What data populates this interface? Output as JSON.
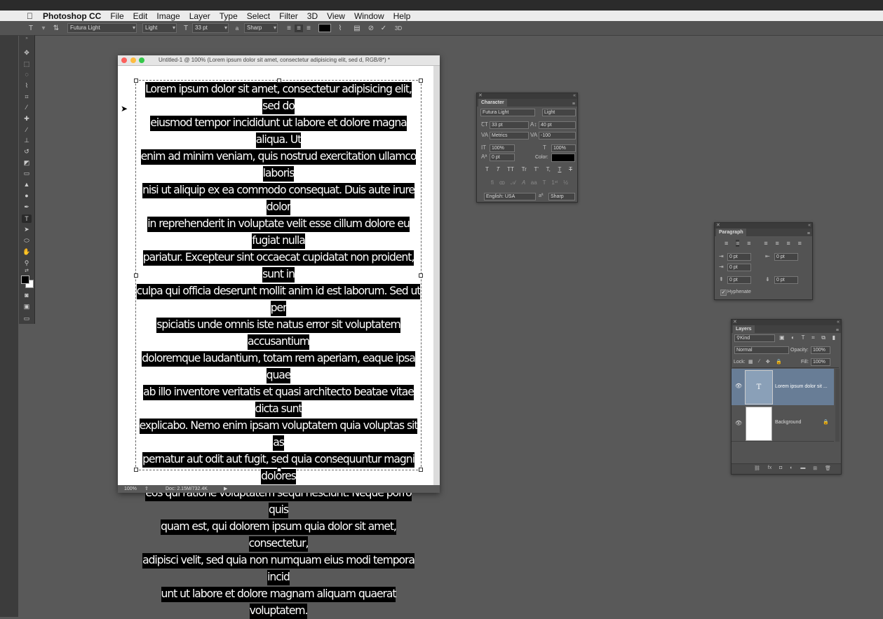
{
  "menubar": {
    "app_name": "Photoshop CC",
    "items": [
      "File",
      "Edit",
      "Image",
      "Layer",
      "Type",
      "Select",
      "Filter",
      "3D",
      "View",
      "Window",
      "Help"
    ]
  },
  "options_bar": {
    "font_family": "Futura Light",
    "font_style": "Light",
    "font_size": "33 pt",
    "aa_label": "a",
    "antialias": "Sharp",
    "text_color": "#000000"
  },
  "document": {
    "title": "Untitled-1 @ 100% (Lorem ipsum dolor sit amet, consectetur adipisicing elit, sed d, RGB/8*) *",
    "zoom": "100%",
    "doc_info": "Doc: 2.15M/732.4K",
    "text_lines": [
      "Lorem ipsum dolor sit amet, consectetur adipisicing elit, sed do",
      "eiusmod tempor incididunt ut labore et dolore magna aliqua. Ut",
      "enim ad minim veniam, quis nostrud exercitation ullamco laboris",
      "nisi ut aliquip ex ea commodo consequat. Duis aute irure dolor",
      "in reprehenderit in voluptate velit esse cillum dolore eu fugiat nulla",
      "pariatur. Excepteur sint occaecat cupidatat non proident, sunt in",
      "culpa qui officia deserunt mollit anim id est laborum. Sed ut per",
      "spiciatis unde omnis iste natus error sit voluptatem accusantium",
      "doloremque laudantium, totam rem aperiam, eaque ipsa quae",
      "ab illo inventore veritatis et quasi architecto beatae vitae dicta sunt",
      "explicabo. Nemo enim ipsam voluptatem quia voluptas sit as",
      "pernatur aut odit aut fugit, sed quia consequuntur magni dolores",
      "eos qui ratione voluptatem sequi nesciunt. Neque porro quis",
      "quam est, qui dolorem ipsum quia dolor sit amet, consectetur,",
      "adipisci velit, sed quia non numquam eius modi tempora incid",
      "unt ut labore et dolore magnam aliquam quaerat voluptatem."
    ]
  },
  "character_panel": {
    "tab": "Character",
    "font_family": "Futura Light",
    "font_style": "Light",
    "font_size": "33 pt",
    "leading": "40 pt",
    "kerning": "Metrics",
    "tracking": "-100",
    "vertical_scale": "100%",
    "horizontal_scale": "100%",
    "baseline_shift": "0 pt",
    "color_label": "Color:",
    "language": "English: USA",
    "aa_label": "a",
    "antialias": "Sharp",
    "style_buttons": [
      "T",
      "T",
      "TT",
      "Tr",
      "T'",
      "T,",
      "T",
      "T"
    ]
  },
  "paragraph_panel": {
    "tab": "Paragraph",
    "indent_left": "0 pt",
    "indent_right": "0 pt",
    "indent_first": "0 pt",
    "space_before": "0 pt",
    "space_after": "0 pt",
    "hyphenate": "Hyphenate",
    "hyphenate_checked": true
  },
  "layers_panel": {
    "tab": "Layers",
    "filter_kind": "Kind",
    "blend_mode": "Normal",
    "opacity_label": "Opacity:",
    "opacity": "100%",
    "lock_label": "Lock:",
    "fill_label": "Fill:",
    "fill": "100%",
    "layers": [
      {
        "name": "Lorem ipsum dolor sit ...",
        "type": "text",
        "selected": true,
        "thumb": "T"
      },
      {
        "name": "Background",
        "type": "pixel",
        "selected": false,
        "locked": true
      }
    ]
  }
}
